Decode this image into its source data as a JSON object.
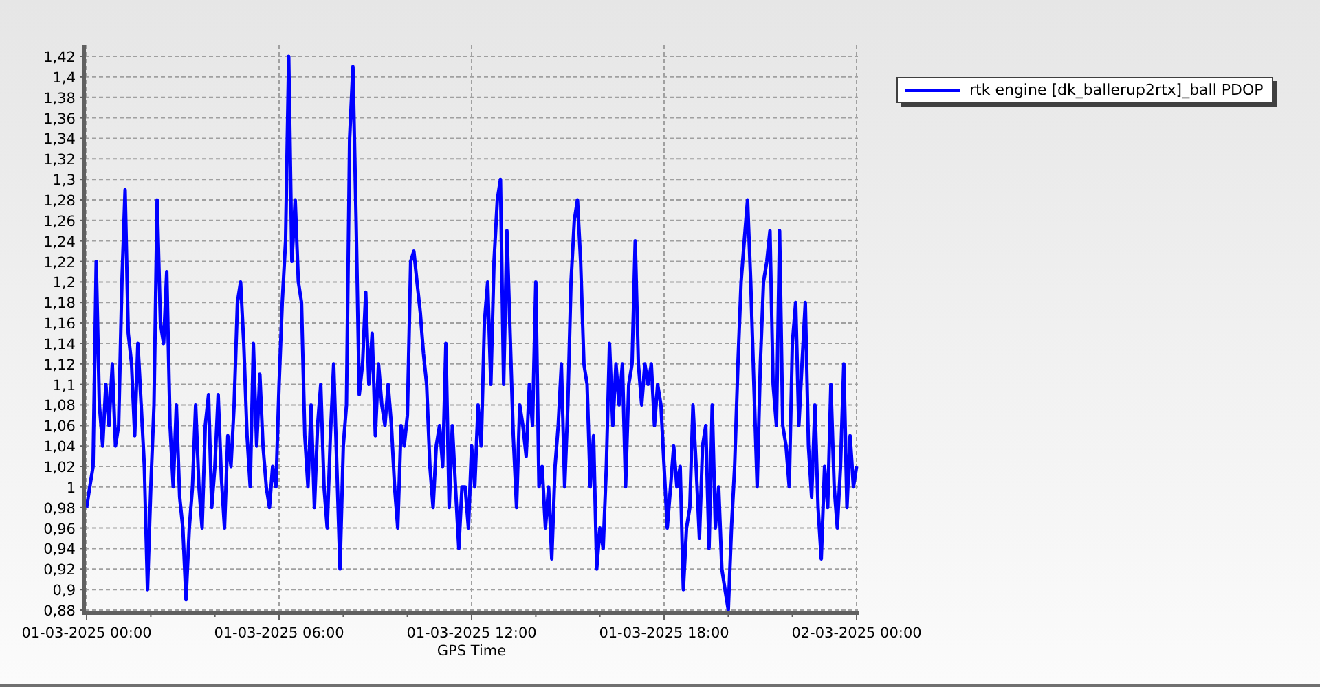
{
  "chart": {
    "chart_data": {
      "type": "line",
      "grid": true,
      "xlabel": "GPS Time",
      "categories": [
        "01-03-2025 00:00",
        null,
        null,
        null,
        null,
        null,
        null,
        null,
        null,
        null,
        null,
        null,
        null,
        null,
        null,
        null,
        null,
        null,
        null,
        null,
        null,
        null,
        null,
        null,
        null,
        null,
        null,
        null,
        null,
        null,
        null,
        null,
        null,
        null,
        null,
        null,
        null,
        null,
        null,
        null,
        null,
        null,
        null,
        null,
        null,
        null,
        null,
        null,
        null,
        null,
        null,
        null,
        null,
        null,
        null,
        null,
        null,
        null,
        null,
        null,
        "01-03-2025 06:00",
        null,
        null,
        null,
        null,
        null,
        null,
        null,
        null,
        null,
        null,
        null,
        null,
        null,
        null,
        null,
        null,
        null,
        null,
        null,
        null,
        null,
        null,
        null,
        null,
        null,
        null,
        null,
        null,
        null,
        null,
        null,
        null,
        null,
        null,
        null,
        null,
        null,
        null,
        null,
        null,
        null,
        null,
        null,
        null,
        null,
        null,
        null,
        null,
        null,
        null,
        null,
        null,
        null,
        null,
        null,
        null,
        null,
        null,
        null,
        "01-03-2025 12:00",
        null,
        null,
        null,
        null,
        null,
        null,
        null,
        null,
        null,
        null,
        null,
        null,
        null,
        null,
        null,
        null,
        null,
        null,
        null,
        null,
        null,
        null,
        null,
        null,
        null,
        null,
        null,
        null,
        null,
        null,
        null,
        null,
        null,
        null,
        null,
        null,
        null,
        null,
        null,
        null,
        null,
        null,
        null,
        null,
        null,
        null,
        null,
        null,
        null,
        null,
        null,
        null,
        null,
        null,
        null,
        null,
        null,
        null,
        null,
        "01-03-2025 18:00",
        null,
        null,
        null,
        null,
        null,
        null,
        null,
        null,
        null,
        null,
        null,
        null,
        null,
        null,
        null,
        null,
        null,
        null,
        null,
        null,
        null,
        null,
        null,
        null,
        null,
        null,
        null,
        null,
        null,
        null,
        null,
        null,
        null,
        null,
        null,
        null,
        null,
        null,
        null,
        null,
        null,
        null,
        null,
        null,
        null,
        null,
        null,
        null,
        null,
        null,
        null,
        null,
        null,
        null,
        null,
        null,
        null,
        null,
        null,
        "02-03-2025 00:00"
      ],
      "ylim": [
        0.88,
        1.42
      ],
      "yticks": [
        {
          "value": 0.88,
          "label": "0,88"
        },
        {
          "value": 0.9,
          "label": "0,9"
        },
        {
          "value": 0.92,
          "label": "0,92"
        },
        {
          "value": 0.94,
          "label": "0,94"
        },
        {
          "value": 0.96,
          "label": "0,96"
        },
        {
          "value": 0.98,
          "label": "0,98"
        },
        {
          "value": 1,
          "label": "1"
        },
        {
          "value": 1.02,
          "label": "1,02"
        },
        {
          "value": 1.04,
          "label": "1,04"
        },
        {
          "value": 1.06,
          "label": "1,06"
        },
        {
          "value": 1.08,
          "label": "1,08"
        },
        {
          "value": 1.1,
          "label": "1,1"
        },
        {
          "value": 1.12,
          "label": "1,12"
        },
        {
          "value": 1.14,
          "label": "1,14"
        },
        {
          "value": 1.16,
          "label": "1,16"
        },
        {
          "value": 1.18,
          "label": "1,18"
        },
        {
          "value": 1.2,
          "label": "1,2"
        },
        {
          "value": 1.22,
          "label": "1,22"
        },
        {
          "value": 1.24,
          "label": "1,24"
        },
        {
          "value": 1.26,
          "label": "1,26"
        },
        {
          "value": 1.28,
          "label": "1,28"
        },
        {
          "value": 1.3,
          "label": "1,3"
        },
        {
          "value": 1.32,
          "label": "1,32"
        },
        {
          "value": 1.34,
          "label": "1,34"
        },
        {
          "value": 1.36,
          "label": "1,36"
        },
        {
          "value": 1.38,
          "label": "1,38"
        },
        {
          "value": 1.4,
          "label": "1,4"
        },
        {
          "value": 1.42,
          "label": "1,42"
        }
      ],
      "series": [
        {
          "name": "rtk engine [dk_ballerup2rtx]_ball PDOP",
          "color": "#0000ff",
          "values": [
            0.98,
            1.0,
            1.02,
            1.22,
            1.08,
            1.04,
            1.1,
            1.06,
            1.12,
            1.04,
            1.06,
            1.2,
            1.29,
            1.15,
            1.12,
            1.05,
            1.14,
            1.08,
            1.02,
            0.9,
            1.0,
            1.08,
            1.28,
            1.16,
            1.14,
            1.21,
            1.06,
            1.0,
            1.08,
            0.99,
            0.96,
            0.89,
            0.96,
            1.0,
            1.08,
            1.0,
            0.96,
            1.06,
            1.09,
            0.98,
            1.02,
            1.09,
            1.01,
            0.96,
            1.05,
            1.02,
            1.08,
            1.18,
            1.2,
            1.14,
            1.05,
            1.0,
            1.14,
            1.04,
            1.11,
            1.04,
            1.0,
            0.98,
            1.02,
            1.0,
            1.1,
            1.18,
            1.24,
            1.42,
            1.22,
            1.28,
            1.2,
            1.18,
            1.05,
            1.0,
            1.08,
            0.98,
            1.06,
            1.1,
            1.0,
            0.96,
            1.05,
            1.12,
            1.02,
            0.92,
            1.04,
            1.08,
            1.34,
            1.41,
            1.26,
            1.09,
            1.12,
            1.19,
            1.1,
            1.15,
            1.05,
            1.12,
            1.08,
            1.06,
            1.1,
            1.06,
            1.0,
            0.96,
            1.06,
            1.04,
            1.07,
            1.22,
            1.23,
            1.2,
            1.17,
            1.13,
            1.1,
            1.02,
            0.98,
            1.04,
            1.06,
            1.02,
            1.14,
            0.98,
            1.06,
            1.0,
            0.94,
            1.0,
            1.0,
            0.96,
            1.04,
            1.0,
            1.08,
            1.04,
            1.16,
            1.2,
            1.1,
            1.22,
            1.28,
            1.3,
            1.1,
            1.25,
            1.15,
            1.05,
            0.98,
            1.08,
            1.06,
            1.03,
            1.1,
            1.06,
            1.2,
            1.0,
            1.02,
            0.96,
            1.0,
            0.93,
            1.02,
            1.06,
            1.12,
            1.0,
            1.08,
            1.2,
            1.26,
            1.28,
            1.22,
            1.12,
            1.1,
            1.0,
            1.05,
            0.92,
            0.96,
            0.94,
            1.02,
            1.14,
            1.06,
            1.12,
            1.08,
            1.12,
            1.0,
            1.1,
            1.12,
            1.24,
            1.12,
            1.08,
            1.12,
            1.1,
            1.12,
            1.06,
            1.1,
            1.08,
            1.02,
            0.96,
            1.0,
            1.04,
            1.0,
            1.02,
            0.9,
            0.96,
            0.98,
            1.08,
            1.02,
            0.95,
            1.04,
            1.06,
            0.94,
            1.08,
            0.96,
            1.0,
            0.92,
            0.9,
            0.88,
            0.96,
            1.02,
            1.12,
            1.2,
            1.24,
            1.28,
            1.2,
            1.1,
            1.0,
            1.12,
            1.2,
            1.22,
            1.25,
            1.1,
            1.06,
            1.25,
            1.06,
            1.04,
            1.0,
            1.14,
            1.18,
            1.06,
            1.12,
            1.18,
            1.04,
            0.99,
            1.08,
            0.98,
            0.93,
            1.02,
            0.98,
            1.1,
            1.0,
            0.96,
            1.02,
            1.12,
            0.98,
            1.05,
            1.0,
            1.02
          ]
        }
      ]
    }
  }
}
